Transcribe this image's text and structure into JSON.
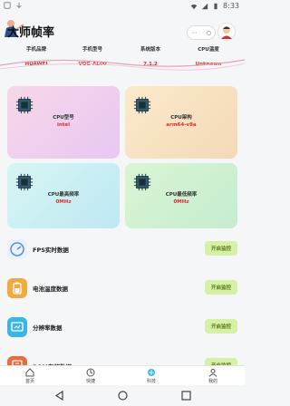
{
  "status_bar": {
    "time": "8:33"
  },
  "header": {
    "title": "大师帧率",
    "capsule_left": "⋯",
    "capsule_right": "○"
  },
  "device_info": [
    {
      "label": "手机品牌",
      "value": "HUAWEI"
    },
    {
      "label": "手机型号",
      "value": "VOG-AL00"
    },
    {
      "label": "系统版本",
      "value": "7.1.2"
    },
    {
      "label": "CPU温度",
      "value": "Unknown"
    }
  ],
  "cards": [
    {
      "label": "CPU型号",
      "value": "intel",
      "color_from": "#f8d7e8",
      "color_to": "#e8c7f4"
    },
    {
      "label": "CPU架构",
      "value": "arm64-v8a",
      "color_from": "#fbeacb",
      "color_to": "#f4d9b8"
    },
    {
      "label": "CPU最高频率",
      "value": "0MHz",
      "color_from": "#d6f6f2",
      "color_to": "#bfe8f4"
    },
    {
      "label": "CPU最低频率",
      "value": "0MHz",
      "color_from": "#d9f6d2",
      "color_to": "#c6ecd2"
    }
  ],
  "features": [
    {
      "label": "FPS实时数据",
      "button": "开启监控",
      "icon": "fps-icon"
    },
    {
      "label": "电池温度数据",
      "button": "开启监控",
      "icon": "battery-icon"
    },
    {
      "label": "分辨率数据",
      "button": "开启监控",
      "icon": "resolution-icon"
    },
    {
      "label": "ROM存储数据",
      "button": "开启监控",
      "icon": "storage-icon"
    }
  ],
  "tabs": [
    {
      "label": "首页",
      "icon": "home-icon"
    },
    {
      "label": "快捷",
      "icon": "shortcut-icon"
    },
    {
      "label": "科技",
      "icon": "tech-icon"
    },
    {
      "label": "我的",
      "icon": "profile-icon"
    }
  ],
  "colors": {
    "accent_red": "#d83030",
    "button_bg": "#d6f0a8",
    "button_text": "#5a7a14"
  }
}
